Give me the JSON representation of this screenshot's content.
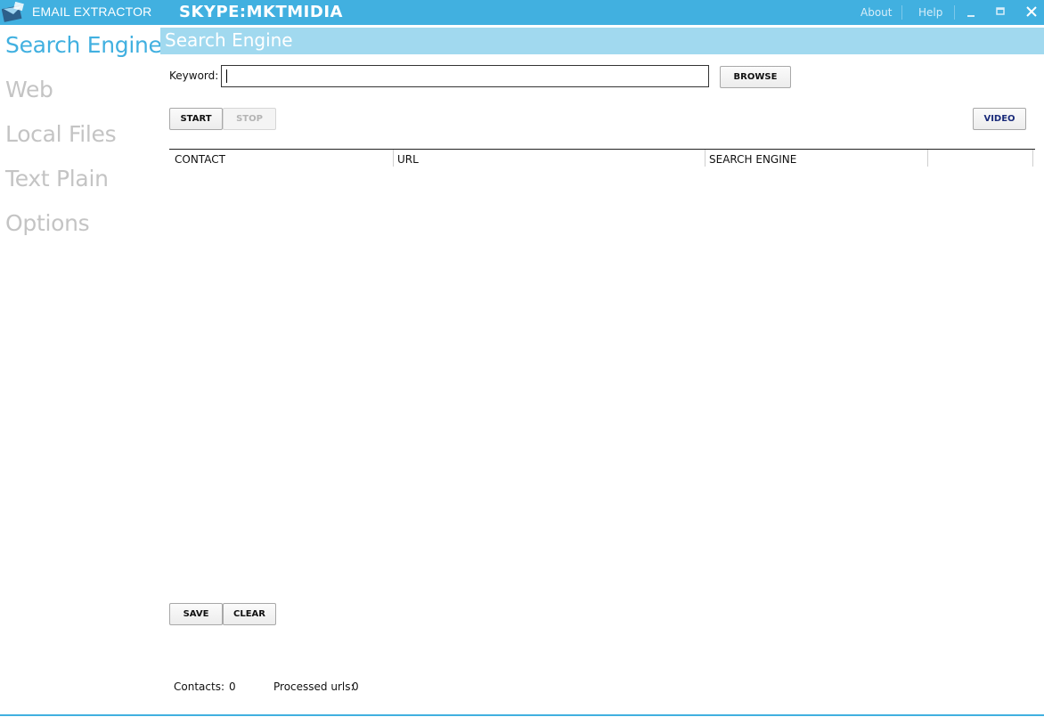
{
  "titlebar": {
    "app_title": "EMAIL EXTRACTOR",
    "banner": "SKYPE:MKTMIDIA",
    "about": "About",
    "help": "Help",
    "accent_color": "#41b0e0"
  },
  "nav": {
    "items": [
      {
        "label": "Search Engine",
        "active": true
      },
      {
        "label": "Web"
      },
      {
        "label": "Local Files"
      },
      {
        "label": "Text Plain"
      },
      {
        "label": "Options"
      }
    ]
  },
  "page": {
    "title": "Search Engine",
    "keyword_label": "Keyword:",
    "keyword_value": "",
    "browse_label": "BROWSE",
    "start_label": "START",
    "stop_label": "STOP",
    "video_label": "VIDEO",
    "save_label": "SAVE",
    "clear_label": "CLEAR"
  },
  "table": {
    "columns": [
      "CONTACT",
      "URL",
      "SEARCH ENGINE",
      ""
    ],
    "rows": []
  },
  "status": {
    "contacts_label": "Contacts:",
    "contacts_value": "0",
    "processed_label": "Processed urls:",
    "processed_value": "0"
  }
}
